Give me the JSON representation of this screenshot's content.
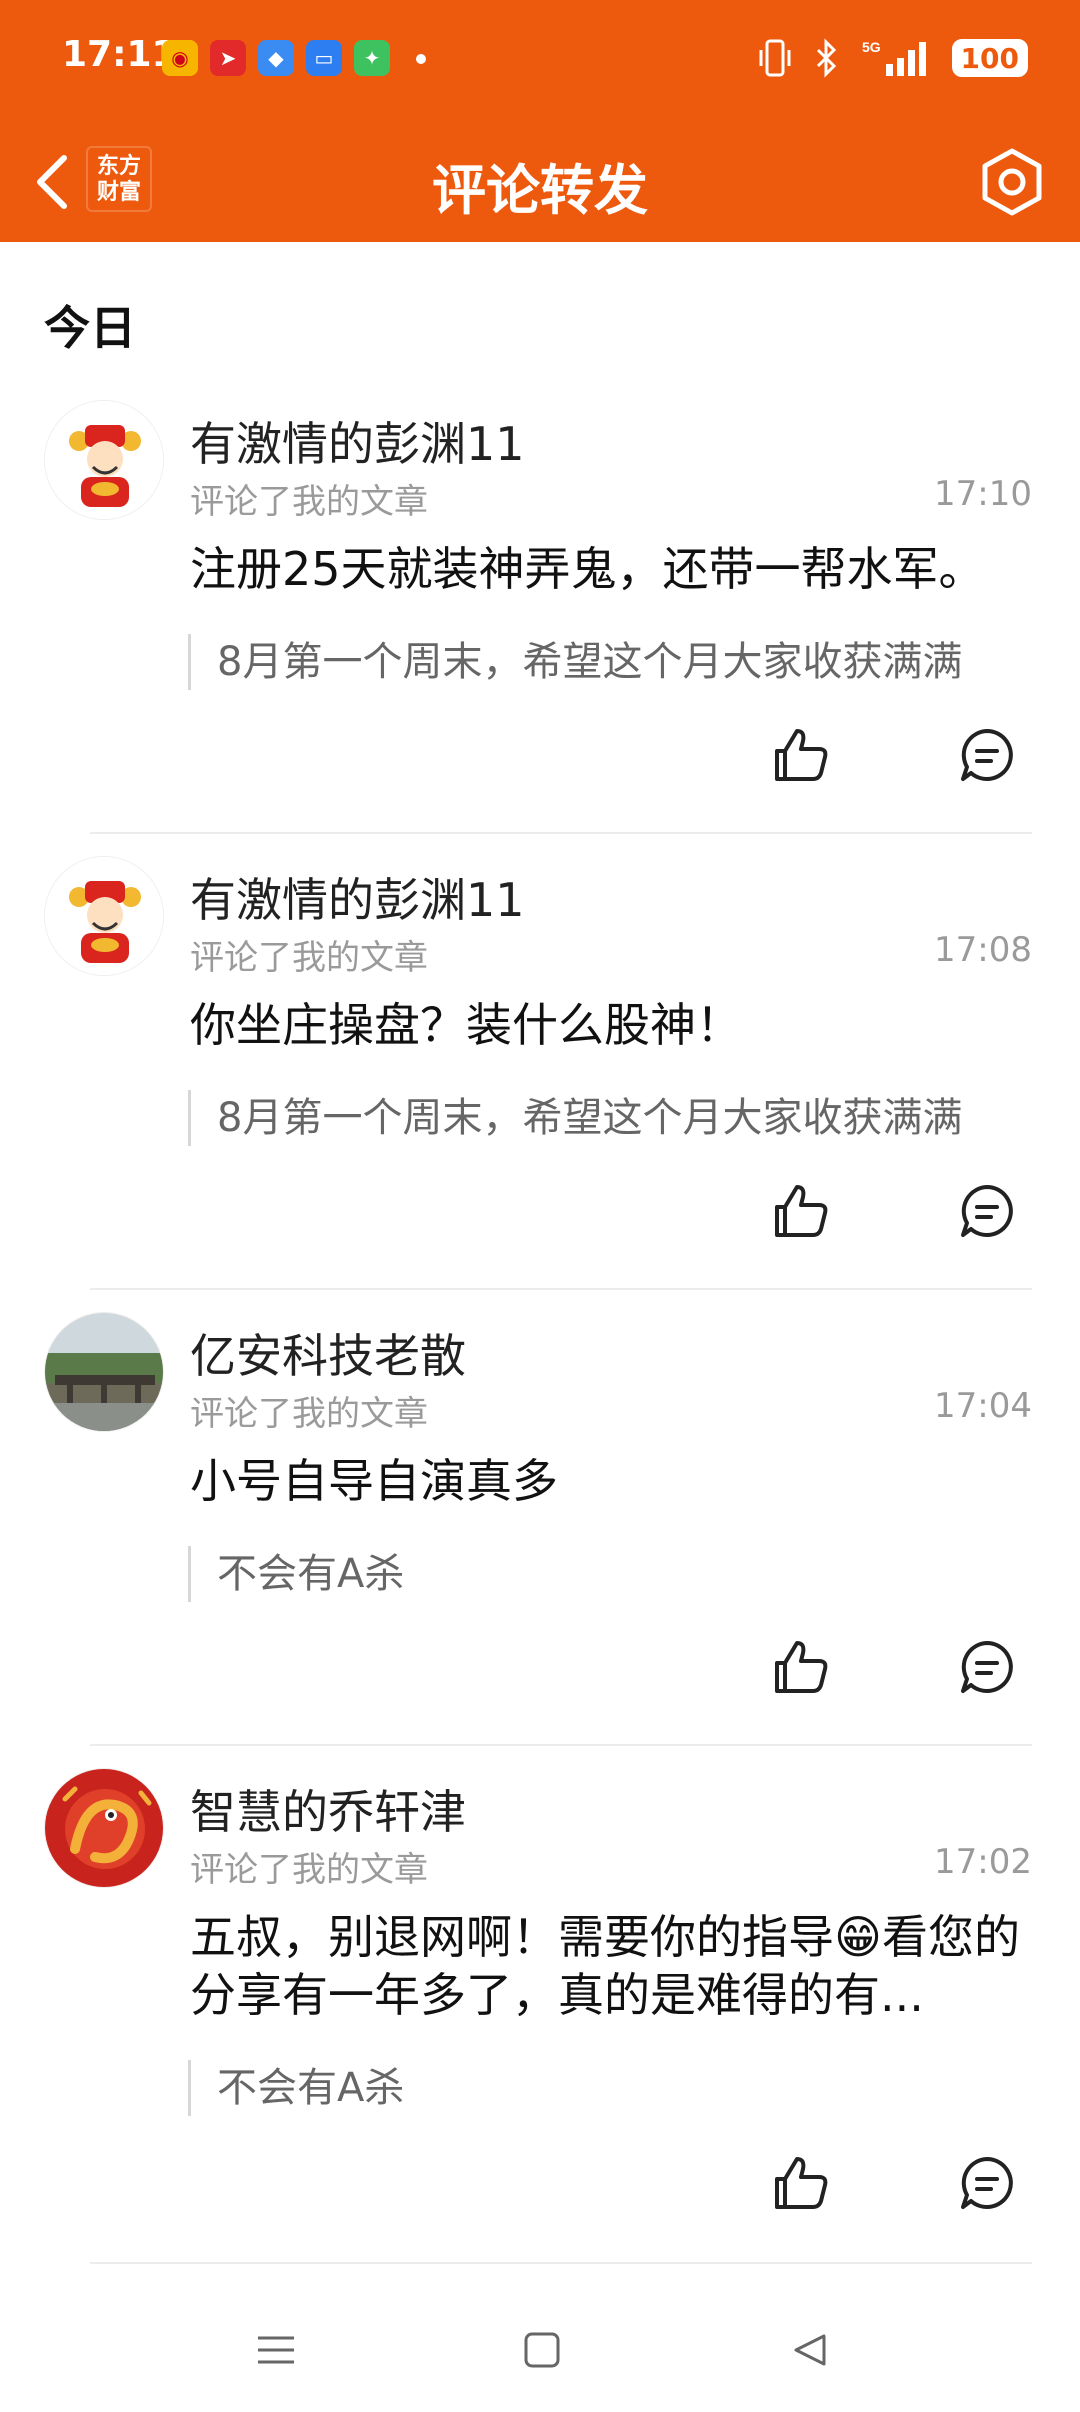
{
  "status_bar": {
    "time": "17:11",
    "battery": "100",
    "network": "5G"
  },
  "header": {
    "brand": "东方财富",
    "title": "评论转发"
  },
  "section": {
    "label": "今日"
  },
  "items": [
    {
      "name": "有激情的彭渊11",
      "action": "评论了我的文章",
      "time": "17:10",
      "comment": "注册25天就装神弄鬼，还带一帮水军。",
      "quote": "8月第一个周末，希望这个月大家收获满满",
      "avatar": "caishen-avatar"
    },
    {
      "name": "有激情的彭渊11",
      "action": "评论了我的文章",
      "time": "17:08",
      "comment": "你坐庄操盘？装什么股神！",
      "quote": "8月第一个周末，希望这个月大家收获满满",
      "avatar": "caishen-avatar"
    },
    {
      "name": "亿安科技老散",
      "action": "评论了我的文章",
      "time": "17:04",
      "comment": "小号自导自演真多",
      "quote": "不会有A杀",
      "avatar": "bridge-photo-avatar"
    },
    {
      "name": "智慧的乔轩津",
      "action": "评论了我的文章",
      "time": "17:02",
      "comment": "五叔，别退网啊！需要你的指导😁看您的分享有一年多了，真的是难得的有...",
      "quote": "不会有A杀",
      "avatar": "dragon-avatar"
    }
  ],
  "colors": {
    "brand_orange": "#ee5a0d",
    "muted_text": "#9a9a9a",
    "divider": "#ececec"
  }
}
